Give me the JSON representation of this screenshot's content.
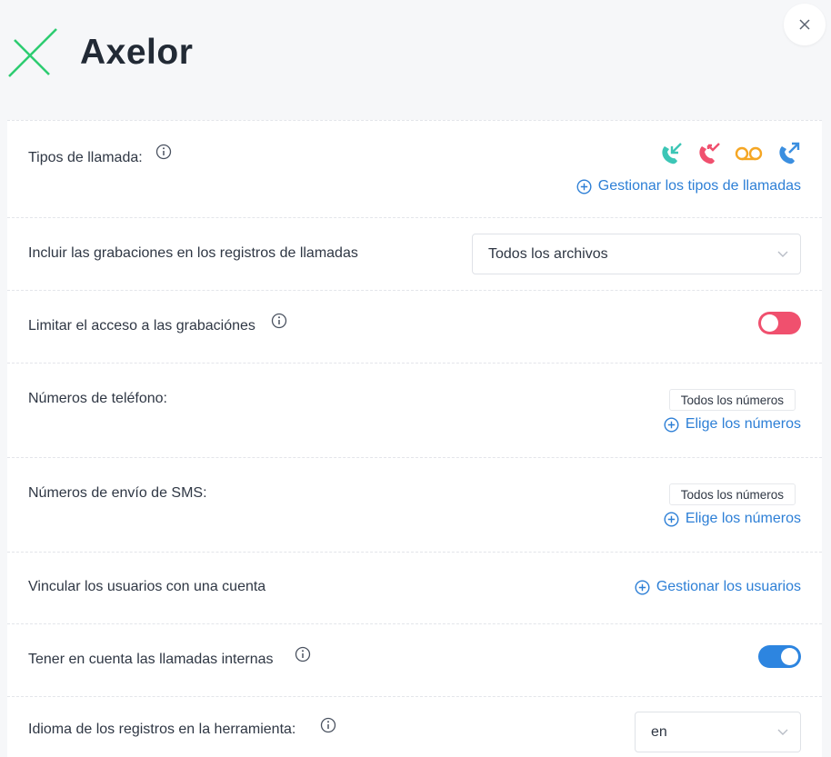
{
  "header": {
    "brand": "Axelor",
    "logo_color": "#2ecc71"
  },
  "rows": {
    "call_types": {
      "label": "Tipos de llamada:",
      "link": "Gestionar los tipos de llamadas",
      "icons": [
        "incoming-call-icon",
        "missed-call-icon",
        "voicemail-icon",
        "outgoing-call-icon"
      ],
      "colors": {
        "incoming": "#3cc6b6",
        "missed": "#f0506e",
        "voicemail": "#f5a623",
        "outgoing": "#3b8fe0"
      }
    },
    "recordings": {
      "label": "Incluir las grabaciones en los registros de llamadas",
      "value": "Todos los archivos"
    },
    "limit_access": {
      "label": "Limitar el acceso a las grabaciónes",
      "enabled": false
    },
    "phone_numbers": {
      "label": "Números de teléfono:",
      "chip": "Todos los números",
      "link": "Elige los números"
    },
    "sms_numbers": {
      "label": "Números de envío de SMS:",
      "chip": "Todos los números",
      "link": "Elige los números"
    },
    "link_users": {
      "label": "Vincular los usuarios con una cuenta",
      "link": "Gestionar los usuarios"
    },
    "internal_calls": {
      "label": "Tener en cuenta las llamadas internas",
      "enabled": true
    },
    "language": {
      "label": "Idioma de los registros en la herramienta:",
      "value": "en"
    }
  },
  "colors": {
    "link": "#2d7fd6",
    "toggle_on": "#2d85e0",
    "toggle_off": "#f0506e"
  }
}
